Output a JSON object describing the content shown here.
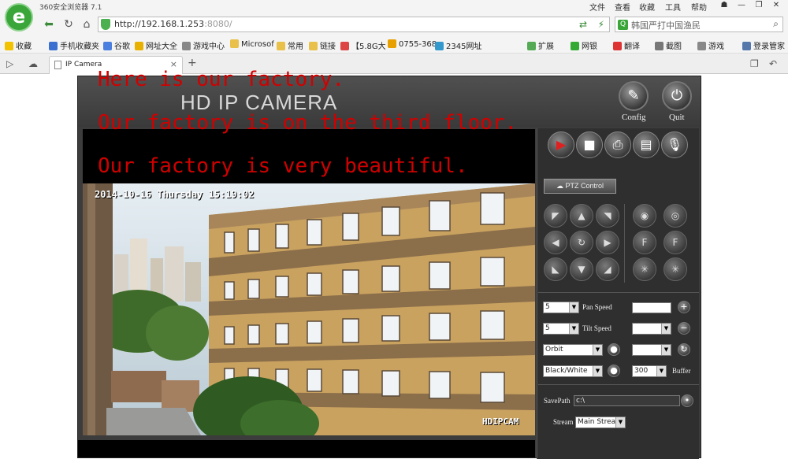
{
  "browser": {
    "title": "360安全浏览器 7.1",
    "logo_letter": "e",
    "menu": [
      "文件",
      "查看",
      "收藏",
      "工具",
      "帮助"
    ],
    "address_host": "http://192.168.1.253",
    "address_rest": ":8080/",
    "search_text": "韩国严打中国渔民",
    "favorites": [
      "收藏",
      "手机收藏夹",
      "谷歌",
      "网址大全",
      "游戏中心",
      "Microsof",
      "常用",
      "链接",
      "【5.8G大",
      "0755-368",
      "2345网址",
      "扩展",
      "网银",
      "翻译",
      "截图",
      "游戏",
      "登录管家"
    ],
    "tab_label": "IP Camera",
    "tab_close": "×",
    "new_tab": "+"
  },
  "camera": {
    "title": "HD IP CAMERA",
    "config_label": "Config",
    "quit_label": "Quit",
    "overlay_line1": "Here is our factory.",
    "overlay_line2": "Our factory is on the third floor.",
    "overlay_line3": "Our factory is very beautiful.",
    "timestamp": "2014-10-16 Thursday 15:19:02",
    "osd_label": "HDIPCAM",
    "ptz_label": "PTZ Control",
    "pan_speed_value": "5",
    "pan_speed_label": "Pan Speed",
    "tilt_speed_value": "5",
    "tilt_speed_label": "Tilt Speed",
    "orbit_value": "Orbit",
    "color_mode_value": "Black/White",
    "buffer_value": "300",
    "buffer_label": "Buffer",
    "savepath_label": "SavePath",
    "savepath_value": "c:\\",
    "stream_label": "Stream",
    "stream_value": "Main Strea"
  },
  "colors": {
    "overlay_text": "#d10000",
    "panel_bg": "#3c3c3c",
    "building_wall": "#c9a260",
    "browser_green": "#3aa63a"
  }
}
